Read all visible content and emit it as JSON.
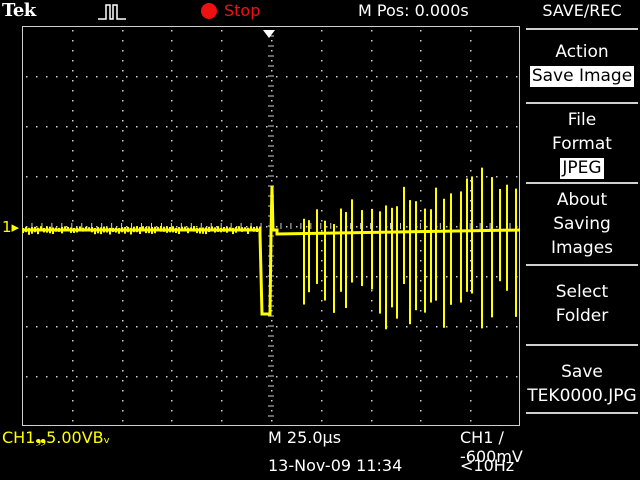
{
  "header": {
    "brand": "Tek",
    "acq_state": "Stop",
    "position": "M Pos: 0.000s"
  },
  "waveform": {
    "channel_marker": "1"
  },
  "menu": {
    "title": "SAVE/REC",
    "action_label": "Action",
    "action_value": "Save Image",
    "file_format_line1": "File",
    "file_format_line2": "Format",
    "file_format_value": "JPEG",
    "about_line1": "About",
    "about_line2": "Saving",
    "about_line3": "Images",
    "select_line1": "Select",
    "select_line2": "Folder",
    "save_line1": "Save",
    "save_line2": "TEK0000.JPG"
  },
  "status": {
    "ch1_scale": "CH1❠5.00VBᵥ",
    "timebase": "M 25.0µs",
    "trigger": "CH1 ∕ -600mV",
    "datetime": "13-Nov-09 11:34",
    "frequency": "<10Hz"
  },
  "colors": {
    "trace": "#ffff00",
    "grid": "#cfcfcf",
    "stop": "#ee1111"
  }
}
